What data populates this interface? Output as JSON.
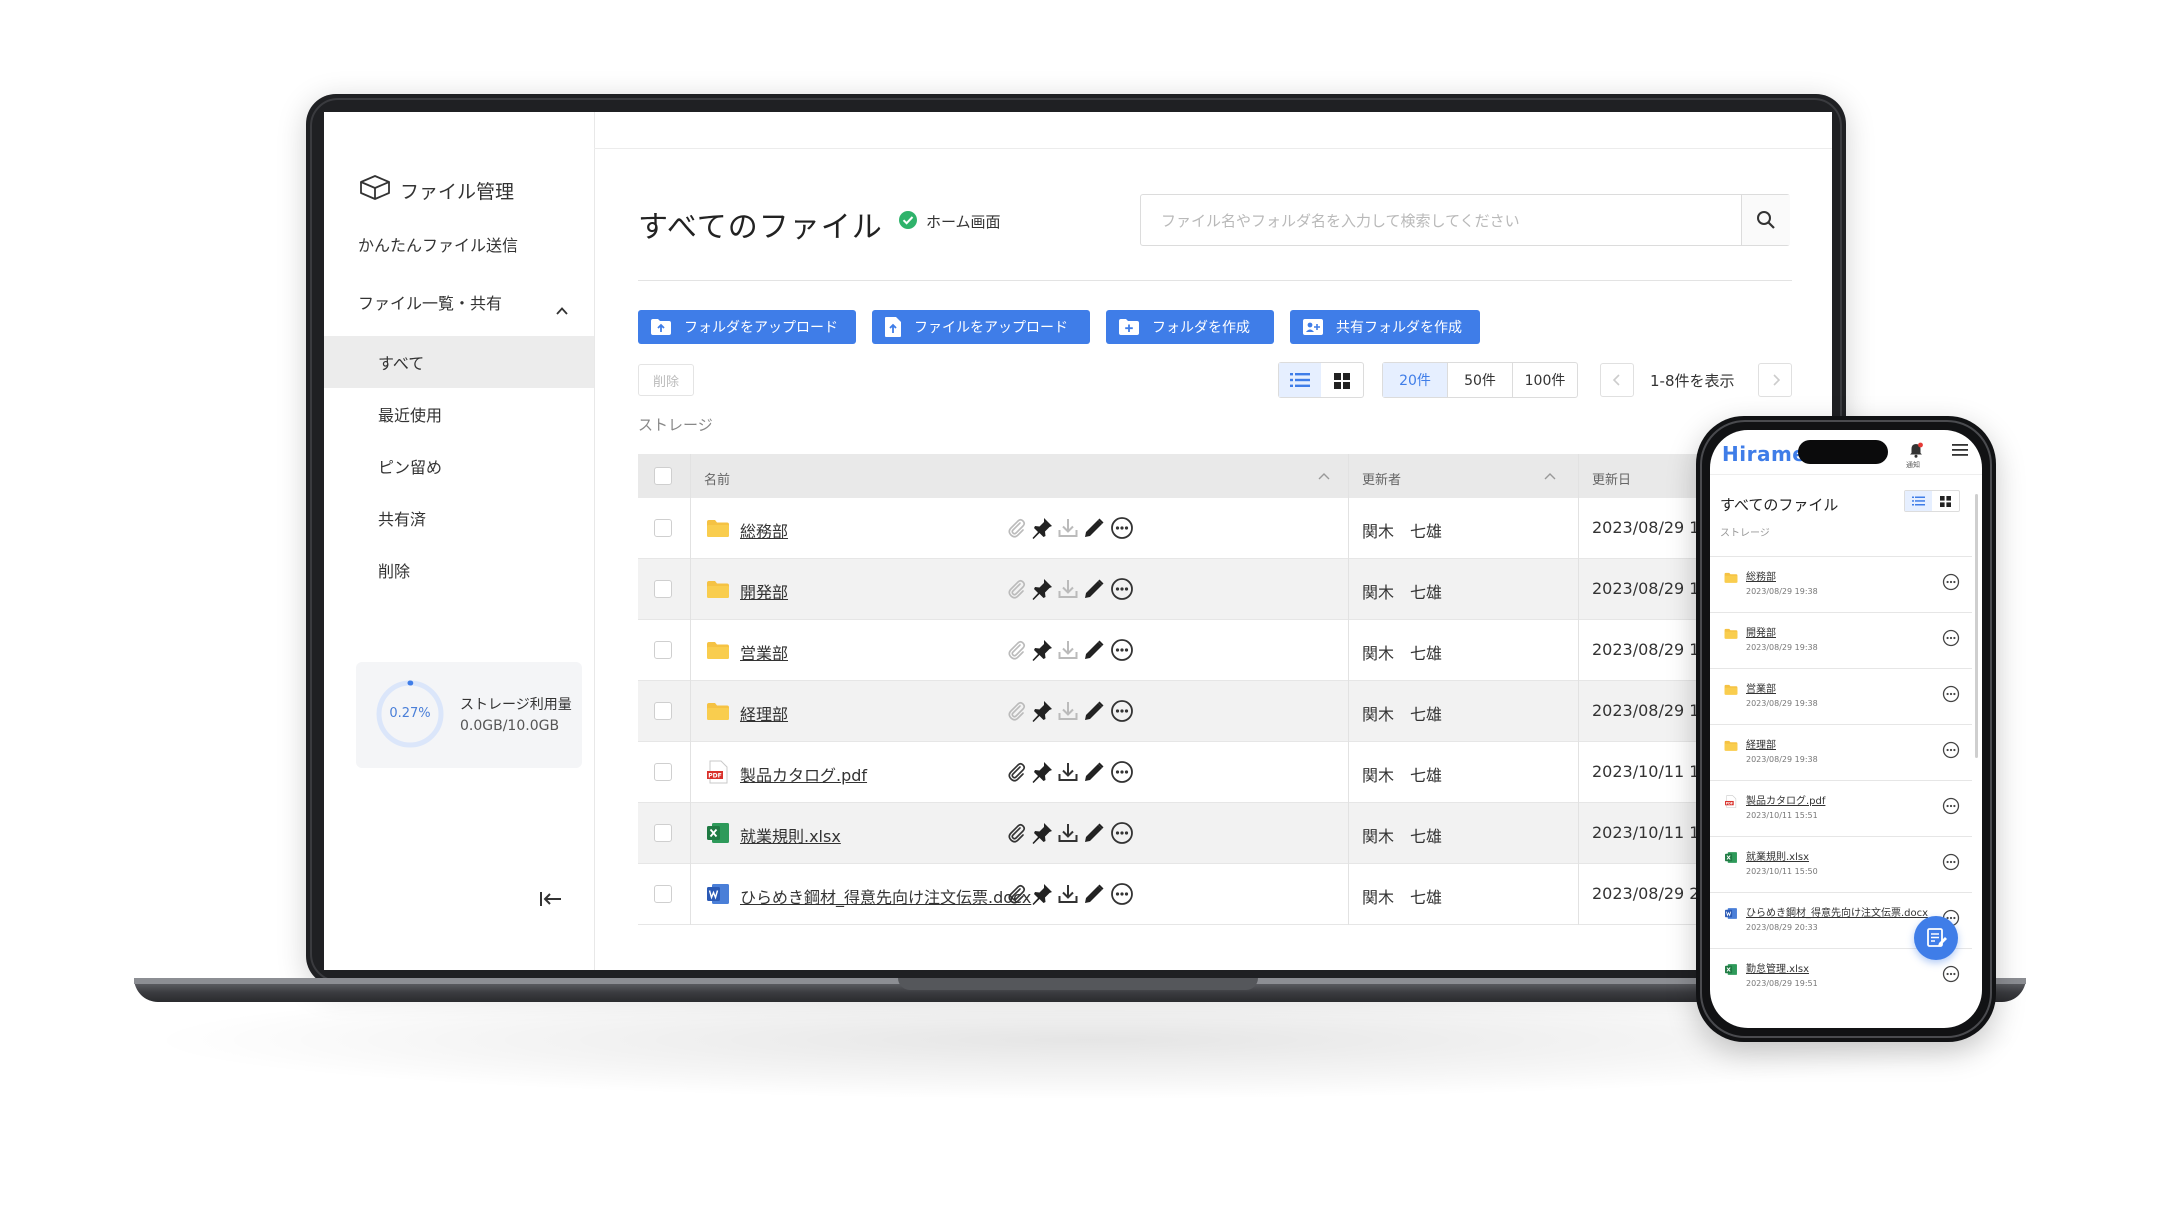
{
  "sidebar": {
    "title": "ファイル管理",
    "quick_send": "かんたんファイル送信",
    "list_share": "ファイル一覧・共有",
    "items": [
      "すべて",
      "最近使用",
      "ピン留め",
      "共有済",
      "削除"
    ],
    "storage": {
      "percent_label": "0.27%",
      "percent": 0.27,
      "label": "ストレージ利用量",
      "value": "0.0GB/10.0GB"
    }
  },
  "main": {
    "title": "すべてのファイル",
    "home_label": "ホーム画面",
    "search_placeholder": "ファイル名やフォルダ名を入力して検索してください",
    "buttons": {
      "upload_folder": "フォルダをアップロード",
      "upload_file": "ファイルをアップロード",
      "create_folder": "フォルダを作成",
      "create_shared_folder": "共有フォルダを作成"
    },
    "delete_label": "削除",
    "page_sizes": [
      "20件",
      "50件",
      "100件"
    ],
    "count_label": "1-8件を表示",
    "section_label": "ストレージ",
    "columns": {
      "name": "名前",
      "updater": "更新者",
      "updated": "更新日"
    },
    "rows": [
      {
        "name": "総務部",
        "type": "folder",
        "updater": "関木　七雄",
        "date": "2023/08/29 19"
      },
      {
        "name": "開発部",
        "type": "folder",
        "updater": "関木　七雄",
        "date": "2023/08/29 19"
      },
      {
        "name": "営業部",
        "type": "folder",
        "updater": "関木　七雄",
        "date": "2023/08/29 19"
      },
      {
        "name": "経理部",
        "type": "folder",
        "updater": "関木　七雄",
        "date": "2023/08/29 19"
      },
      {
        "name": "製品カタログ.pdf",
        "type": "pdf",
        "updater": "関木　七雄",
        "date": "2023/10/11 15"
      },
      {
        "name": "就業規則.xlsx",
        "type": "excel",
        "updater": "関木　七雄",
        "date": "2023/10/11 15"
      },
      {
        "name": "ひらめき鋼材_得意先向け注文伝票.docx",
        "type": "word",
        "updater": "関木　七雄",
        "date": "2023/08/29 20"
      }
    ]
  },
  "phone": {
    "brand": "Hirame",
    "notice_label": "通知",
    "title": "すべてのファイル",
    "section_label": "ストレージ",
    "rows": [
      {
        "name": "総務部",
        "type": "folder",
        "date": "2023/08/29 19:38"
      },
      {
        "name": "開発部",
        "type": "folder",
        "date": "2023/08/29 19:38"
      },
      {
        "name": "営業部",
        "type": "folder",
        "date": "2023/08/29 19:38"
      },
      {
        "name": "経理部",
        "type": "folder",
        "date": "2023/08/29 19:38"
      },
      {
        "name": "製品カタログ.pdf",
        "type": "pdf",
        "date": "2023/10/11 15:51"
      },
      {
        "name": "就業規則.xlsx",
        "type": "excel",
        "date": "2023/10/11 15:50"
      },
      {
        "name": "ひらめき鋼材_得意先向け注文伝票.docx",
        "type": "word",
        "date": "2023/08/29 20:33"
      },
      {
        "name": "勤怠管理.xlsx",
        "type": "excel",
        "date": "2023/08/29 19:51"
      }
    ]
  },
  "colors": {
    "accent": "#3f7de8",
    "folder": "#f5c243",
    "excel": "#1f7a43",
    "word": "#2b5ab5",
    "pdf": "#d9312b",
    "success": "#2fb36b"
  }
}
